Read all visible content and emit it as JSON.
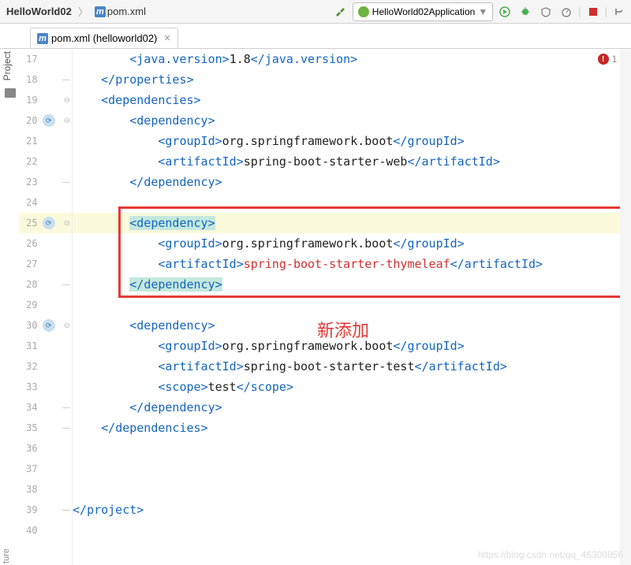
{
  "toolbar": {
    "breadcrumb": {
      "project": "HelloWorld02",
      "file": "pom.xml"
    },
    "run_config": "HelloWorld02Application"
  },
  "tabs": {
    "active": {
      "label": "pom.xml (helloworld02)"
    }
  },
  "sidebars": {
    "project": "Project",
    "structure": "ture"
  },
  "errors": {
    "count": "1"
  },
  "code_lines": [
    {
      "n": "17",
      "indent": "        ",
      "tokens": [
        {
          "t": "<",
          "c": "bracket"
        },
        {
          "t": "java.version",
          "c": "name"
        },
        {
          "t": ">",
          "c": "bracket"
        },
        {
          "t": "1.8",
          "c": "content"
        },
        {
          "t": "</",
          "c": "bracket"
        },
        {
          "t": "java.version",
          "c": "name"
        },
        {
          "t": ">",
          "c": "bracket"
        }
      ]
    },
    {
      "n": "18",
      "indent": "    ",
      "tokens": [
        {
          "t": "</",
          "c": "bracket"
        },
        {
          "t": "properties",
          "c": "name"
        },
        {
          "t": ">",
          "c": "bracket"
        }
      ],
      "fold": "close"
    },
    {
      "n": "19",
      "indent": "    ",
      "tokens": [
        {
          "t": "<",
          "c": "bracket"
        },
        {
          "t": "dependencies",
          "c": "name"
        },
        {
          "t": ">",
          "c": "bracket"
        }
      ],
      "fold": "open"
    },
    {
      "n": "20",
      "indent": "        ",
      "tokens": [
        {
          "t": "<",
          "c": "bracket"
        },
        {
          "t": "dependency",
          "c": "name"
        },
        {
          "t": ">",
          "c": "bracket"
        }
      ],
      "spring": true,
      "fold": "open"
    },
    {
      "n": "21",
      "indent": "            ",
      "tokens": [
        {
          "t": "<",
          "c": "bracket"
        },
        {
          "t": "groupId",
          "c": "name"
        },
        {
          "t": ">",
          "c": "bracket"
        },
        {
          "t": "org.springframework.boot",
          "c": "content"
        },
        {
          "t": "</",
          "c": "bracket"
        },
        {
          "t": "groupId",
          "c": "name"
        },
        {
          "t": ">",
          "c": "bracket"
        }
      ]
    },
    {
      "n": "22",
      "indent": "            ",
      "tokens": [
        {
          "t": "<",
          "c": "bracket"
        },
        {
          "t": "artifactId",
          "c": "name"
        },
        {
          "t": ">",
          "c": "bracket"
        },
        {
          "t": "spring-boot-starter-web",
          "c": "content"
        },
        {
          "t": "</",
          "c": "bracket"
        },
        {
          "t": "artifactId",
          "c": "name"
        },
        {
          "t": ">",
          "c": "bracket"
        }
      ]
    },
    {
      "n": "23",
      "indent": "        ",
      "tokens": [
        {
          "t": "</",
          "c": "bracket"
        },
        {
          "t": "dependency",
          "c": "name"
        },
        {
          "t": ">",
          "c": "bracket"
        }
      ],
      "fold": "close"
    },
    {
      "n": "24",
      "indent": "",
      "tokens": []
    },
    {
      "n": "25",
      "indent": "        ",
      "tokens": [
        {
          "t": "<",
          "c": "bracket",
          "hl": true
        },
        {
          "t": "dependency",
          "c": "name",
          "hl": true
        },
        {
          "t": ">",
          "c": "bracket",
          "hl": true
        }
      ],
      "spring": true,
      "fold": "open",
      "highlight": true
    },
    {
      "n": "26",
      "indent": "            ",
      "tokens": [
        {
          "t": "<",
          "c": "bracket"
        },
        {
          "t": "groupId",
          "c": "name"
        },
        {
          "t": ">",
          "c": "bracket"
        },
        {
          "t": "org.springframework.boot",
          "c": "content"
        },
        {
          "t": "</",
          "c": "bracket"
        },
        {
          "t": "groupId",
          "c": "name"
        },
        {
          "t": ">",
          "c": "bracket"
        }
      ]
    },
    {
      "n": "27",
      "indent": "            ",
      "tokens": [
        {
          "t": "<",
          "c": "bracket"
        },
        {
          "t": "artifactId",
          "c": "name"
        },
        {
          "t": ">",
          "c": "bracket"
        },
        {
          "t": "spring-boot-starter-thymeleaf",
          "c": "red"
        },
        {
          "t": "</",
          "c": "bracket"
        },
        {
          "t": "artifactId",
          "c": "name"
        },
        {
          "t": ">",
          "c": "bracket"
        }
      ]
    },
    {
      "n": "28",
      "indent": "        ",
      "tokens": [
        {
          "t": "</",
          "c": "bracket",
          "hl": true
        },
        {
          "t": "dependency",
          "c": "name",
          "hl": true
        },
        {
          "t": ">",
          "c": "bracket",
          "hl": true
        }
      ],
      "fold": "close"
    },
    {
      "n": "29",
      "indent": "",
      "tokens": []
    },
    {
      "n": "30",
      "indent": "        ",
      "tokens": [
        {
          "t": "<",
          "c": "bracket"
        },
        {
          "t": "dependency",
          "c": "name"
        },
        {
          "t": ">",
          "c": "bracket"
        }
      ],
      "spring": true,
      "fold": "open"
    },
    {
      "n": "31",
      "indent": "            ",
      "tokens": [
        {
          "t": "<",
          "c": "bracket"
        },
        {
          "t": "groupId",
          "c": "name"
        },
        {
          "t": ">",
          "c": "bracket"
        },
        {
          "t": "org.springframework.boot",
          "c": "content"
        },
        {
          "t": "</",
          "c": "bracket"
        },
        {
          "t": "groupId",
          "c": "name"
        },
        {
          "t": ">",
          "c": "bracket"
        }
      ]
    },
    {
      "n": "32",
      "indent": "            ",
      "tokens": [
        {
          "t": "<",
          "c": "bracket"
        },
        {
          "t": "artifactId",
          "c": "name"
        },
        {
          "t": ">",
          "c": "bracket"
        },
        {
          "t": "spring-boot-starter-test",
          "c": "content"
        },
        {
          "t": "</",
          "c": "bracket"
        },
        {
          "t": "artifactId",
          "c": "name"
        },
        {
          "t": ">",
          "c": "bracket"
        }
      ]
    },
    {
      "n": "33",
      "indent": "            ",
      "tokens": [
        {
          "t": "<",
          "c": "bracket"
        },
        {
          "t": "scope",
          "c": "name"
        },
        {
          "t": ">",
          "c": "bracket"
        },
        {
          "t": "test",
          "c": "content"
        },
        {
          "t": "</",
          "c": "bracket"
        },
        {
          "t": "scope",
          "c": "name"
        },
        {
          "t": ">",
          "c": "bracket"
        }
      ]
    },
    {
      "n": "34",
      "indent": "        ",
      "tokens": [
        {
          "t": "</",
          "c": "bracket"
        },
        {
          "t": "dependency",
          "c": "name"
        },
        {
          "t": ">",
          "c": "bracket"
        }
      ],
      "fold": "close"
    },
    {
      "n": "35",
      "indent": "    ",
      "tokens": [
        {
          "t": "</",
          "c": "bracket"
        },
        {
          "t": "dependencies",
          "c": "name"
        },
        {
          "t": ">",
          "c": "bracket"
        }
      ],
      "fold": "close"
    },
    {
      "n": "36",
      "indent": "",
      "tokens": []
    },
    {
      "n": "37",
      "indent": "",
      "tokens": []
    },
    {
      "n": "38",
      "indent": "",
      "tokens": []
    },
    {
      "n": "39",
      "indent": "",
      "tokens": [
        {
          "t": "</",
          "c": "bracket"
        },
        {
          "t": "project",
          "c": "name"
        },
        {
          "t": ">",
          "c": "bracket"
        }
      ],
      "fold": "close"
    },
    {
      "n": "40",
      "indent": "",
      "tokens": []
    }
  ],
  "annotation": "新添加",
  "watermark": "https://blog.csdn.net/qq_46300856"
}
